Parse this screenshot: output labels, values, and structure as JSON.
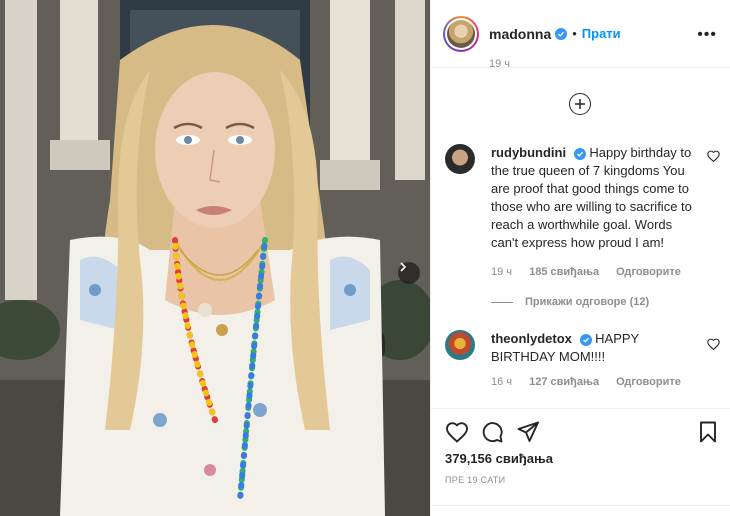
{
  "post": {
    "username": "madonna",
    "follow_label": "Прати",
    "more_label": "•••",
    "partial_time": "19 ч"
  },
  "comments": [
    {
      "username": "rudybundini",
      "text": "Happy birthday to the true queen of 7 kingdoms You are proof that good things come to those who are willing to sacrifice to reach a worthwhile goal. Words can't express how proud I am!",
      "time": "19 ч",
      "likes": "185 свиђања",
      "reply_label": "Одговорите"
    },
    {
      "username": "theonlydetox",
      "text": "HAPPY BIRTHDAY MOM!!!!",
      "time": "16 ч",
      "likes": "127 свиђања",
      "reply_label": "Одговорите"
    }
  ],
  "view_replies_label": "Прикажи одговоре (12)",
  "footer": {
    "likes": "379,156 свиђања",
    "time_ago": "ПРЕ 19 САТИ"
  },
  "icons": {
    "verified": "verified-badge-icon",
    "load_more": "plus-circle-icon",
    "like": "heart-icon",
    "comment": "comment-icon",
    "share": "paper-plane-icon",
    "save": "bookmark-icon",
    "next": "chevron-right-icon",
    "more": "more-options-icon"
  },
  "colors": {
    "accent": "#0095f6",
    "verified": "#3897f0",
    "muted": "#8e8e8e",
    "text": "#262626"
  }
}
